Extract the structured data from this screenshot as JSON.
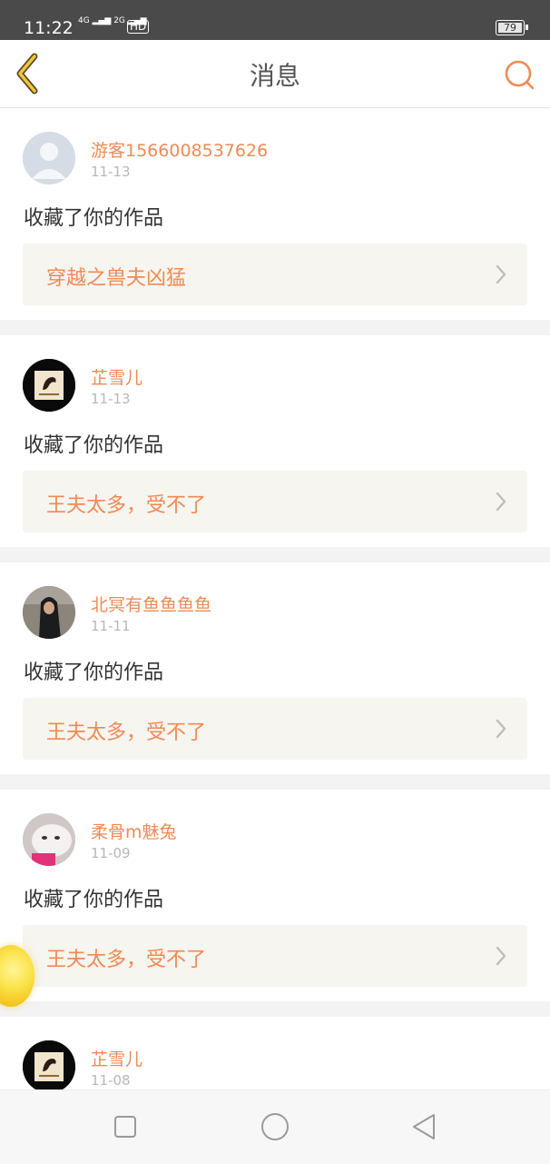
{
  "status_bar": {
    "time": "11:22",
    "network_label_1": "4G",
    "network_label_2": "2G",
    "hd_label": "HD",
    "battery": "79"
  },
  "header": {
    "title": "消息",
    "back_icon": "chevron-left-icon",
    "search_icon": "search-icon"
  },
  "notifications": [
    {
      "user": "游客1566008537626",
      "date": "11-13",
      "action": "收藏了你的作品",
      "work": "穿越之兽夫凶猛",
      "avatar": "default-avatar"
    },
    {
      "user": "芷雪儿",
      "date": "11-13",
      "action": "收藏了你的作品",
      "work": "王夫太多，受不了",
      "avatar": "bird-logo-avatar"
    },
    {
      "user": "北冥有鱼鱼鱼鱼",
      "date": "11-11",
      "action": "收藏了你的作品",
      "work": "王夫太多，受不了",
      "avatar": "photo-avatar"
    },
    {
      "user": "柔骨m魅兔",
      "date": "11-09",
      "action": "收藏了你的作品",
      "work": "王夫太多，受不了",
      "avatar": "cat-photo-avatar"
    },
    {
      "user": "芷雪儿",
      "date": "11-08",
      "action": "",
      "work": "",
      "avatar": "bird-logo-avatar"
    }
  ],
  "colors": {
    "accent": "#f08a55",
    "status_bar": "#4a4a4a",
    "work_bg": "#f6f5ef"
  }
}
